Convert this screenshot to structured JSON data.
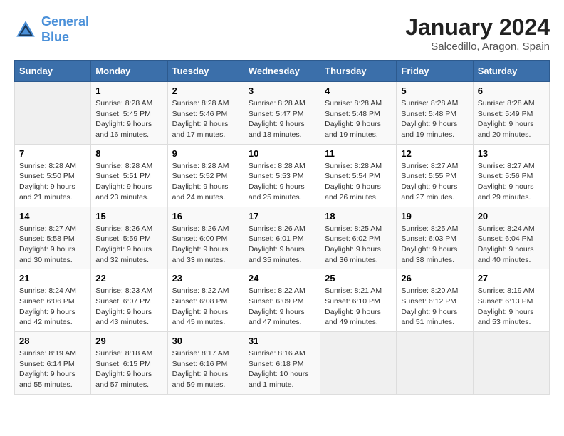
{
  "logo": {
    "line1": "General",
    "line2": "Blue"
  },
  "title": "January 2024",
  "subtitle": "Salcedillo, Aragon, Spain",
  "weekdays": [
    "Sunday",
    "Monday",
    "Tuesday",
    "Wednesday",
    "Thursday",
    "Friday",
    "Saturday"
  ],
  "weeks": [
    [
      {
        "day": "",
        "info": ""
      },
      {
        "day": "1",
        "info": "Sunrise: 8:28 AM\nSunset: 5:45 PM\nDaylight: 9 hours\nand 16 minutes."
      },
      {
        "day": "2",
        "info": "Sunrise: 8:28 AM\nSunset: 5:46 PM\nDaylight: 9 hours\nand 17 minutes."
      },
      {
        "day": "3",
        "info": "Sunrise: 8:28 AM\nSunset: 5:47 PM\nDaylight: 9 hours\nand 18 minutes."
      },
      {
        "day": "4",
        "info": "Sunrise: 8:28 AM\nSunset: 5:48 PM\nDaylight: 9 hours\nand 19 minutes."
      },
      {
        "day": "5",
        "info": "Sunrise: 8:28 AM\nSunset: 5:48 PM\nDaylight: 9 hours\nand 19 minutes."
      },
      {
        "day": "6",
        "info": "Sunrise: 8:28 AM\nSunset: 5:49 PM\nDaylight: 9 hours\nand 20 minutes."
      }
    ],
    [
      {
        "day": "7",
        "info": "Sunrise: 8:28 AM\nSunset: 5:50 PM\nDaylight: 9 hours\nand 21 minutes."
      },
      {
        "day": "8",
        "info": "Sunrise: 8:28 AM\nSunset: 5:51 PM\nDaylight: 9 hours\nand 23 minutes."
      },
      {
        "day": "9",
        "info": "Sunrise: 8:28 AM\nSunset: 5:52 PM\nDaylight: 9 hours\nand 24 minutes."
      },
      {
        "day": "10",
        "info": "Sunrise: 8:28 AM\nSunset: 5:53 PM\nDaylight: 9 hours\nand 25 minutes."
      },
      {
        "day": "11",
        "info": "Sunrise: 8:28 AM\nSunset: 5:54 PM\nDaylight: 9 hours\nand 26 minutes."
      },
      {
        "day": "12",
        "info": "Sunrise: 8:27 AM\nSunset: 5:55 PM\nDaylight: 9 hours\nand 27 minutes."
      },
      {
        "day": "13",
        "info": "Sunrise: 8:27 AM\nSunset: 5:56 PM\nDaylight: 9 hours\nand 29 minutes."
      }
    ],
    [
      {
        "day": "14",
        "info": "Sunrise: 8:27 AM\nSunset: 5:58 PM\nDaylight: 9 hours\nand 30 minutes."
      },
      {
        "day": "15",
        "info": "Sunrise: 8:26 AM\nSunset: 5:59 PM\nDaylight: 9 hours\nand 32 minutes."
      },
      {
        "day": "16",
        "info": "Sunrise: 8:26 AM\nSunset: 6:00 PM\nDaylight: 9 hours\nand 33 minutes."
      },
      {
        "day": "17",
        "info": "Sunrise: 8:26 AM\nSunset: 6:01 PM\nDaylight: 9 hours\nand 35 minutes."
      },
      {
        "day": "18",
        "info": "Sunrise: 8:25 AM\nSunset: 6:02 PM\nDaylight: 9 hours\nand 36 minutes."
      },
      {
        "day": "19",
        "info": "Sunrise: 8:25 AM\nSunset: 6:03 PM\nDaylight: 9 hours\nand 38 minutes."
      },
      {
        "day": "20",
        "info": "Sunrise: 8:24 AM\nSunset: 6:04 PM\nDaylight: 9 hours\nand 40 minutes."
      }
    ],
    [
      {
        "day": "21",
        "info": "Sunrise: 8:24 AM\nSunset: 6:06 PM\nDaylight: 9 hours\nand 42 minutes."
      },
      {
        "day": "22",
        "info": "Sunrise: 8:23 AM\nSunset: 6:07 PM\nDaylight: 9 hours\nand 43 minutes."
      },
      {
        "day": "23",
        "info": "Sunrise: 8:22 AM\nSunset: 6:08 PM\nDaylight: 9 hours\nand 45 minutes."
      },
      {
        "day": "24",
        "info": "Sunrise: 8:22 AM\nSunset: 6:09 PM\nDaylight: 9 hours\nand 47 minutes."
      },
      {
        "day": "25",
        "info": "Sunrise: 8:21 AM\nSunset: 6:10 PM\nDaylight: 9 hours\nand 49 minutes."
      },
      {
        "day": "26",
        "info": "Sunrise: 8:20 AM\nSunset: 6:12 PM\nDaylight: 9 hours\nand 51 minutes."
      },
      {
        "day": "27",
        "info": "Sunrise: 8:19 AM\nSunset: 6:13 PM\nDaylight: 9 hours\nand 53 minutes."
      }
    ],
    [
      {
        "day": "28",
        "info": "Sunrise: 8:19 AM\nSunset: 6:14 PM\nDaylight: 9 hours\nand 55 minutes."
      },
      {
        "day": "29",
        "info": "Sunrise: 8:18 AM\nSunset: 6:15 PM\nDaylight: 9 hours\nand 57 minutes."
      },
      {
        "day": "30",
        "info": "Sunrise: 8:17 AM\nSunset: 6:16 PM\nDaylight: 9 hours\nand 59 minutes."
      },
      {
        "day": "31",
        "info": "Sunrise: 8:16 AM\nSunset: 6:18 PM\nDaylight: 10 hours\nand 1 minute."
      },
      {
        "day": "",
        "info": ""
      },
      {
        "day": "",
        "info": ""
      },
      {
        "day": "",
        "info": ""
      }
    ]
  ]
}
